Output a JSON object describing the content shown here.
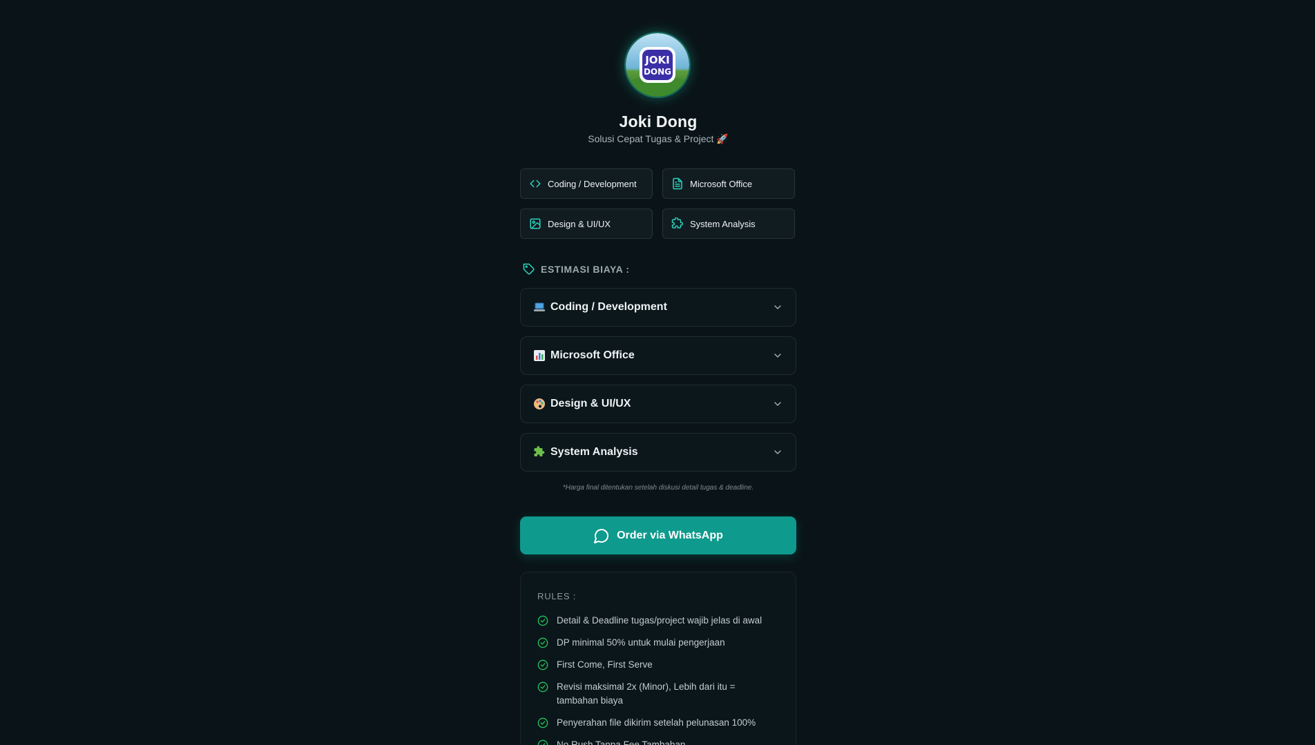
{
  "profile": {
    "avatar_text": "JOKI DONG",
    "name": "Joki Dong",
    "tagline": "Solusi Cepat Tugas & Project 🚀"
  },
  "services": [
    {
      "label": "Coding / Development",
      "icon": "code-icon"
    },
    {
      "label": "Microsoft Office",
      "icon": "document-icon"
    },
    {
      "label": "Design & UI/UX",
      "icon": "image-icon"
    },
    {
      "label": "System Analysis",
      "icon": "puzzle-icon"
    }
  ],
  "estimate": {
    "header": "ESTIMASI BIAYA :",
    "icon": "tag-icon",
    "items": [
      {
        "label": "Coding / Development",
        "emoji": "laptop-emoji"
      },
      {
        "label": "Microsoft Office",
        "emoji": "bar-chart-emoji"
      },
      {
        "label": "Design & UI/UX",
        "emoji": "palette-emoji"
      },
      {
        "label": "System Analysis",
        "emoji": "puzzle-emoji"
      }
    ],
    "note": "*Harga final ditentukan setelah diskusi detail tugas & deadline."
  },
  "order_button": {
    "label": "Order via WhatsApp",
    "icon": "chat-bubble-icon"
  },
  "rules": {
    "title": "RULES :",
    "items": [
      "Detail & Deadline tugas/project wajib jelas di awal",
      "DP minimal 50% untuk mulai pengerjaan",
      "First Come, First Serve",
      "Revisi maksimal 2x (Minor), Lebih dari itu = tambahan biaya",
      "Penyerahan file dikirim setelah pelunasan 100%",
      "No Rush Tanpa Fee Tambahan"
    ]
  },
  "colors": {
    "background": "#0a1418",
    "accent": "#0e9a8c",
    "icon_teal": "#2dd4bf",
    "check_green": "#22c55e"
  }
}
